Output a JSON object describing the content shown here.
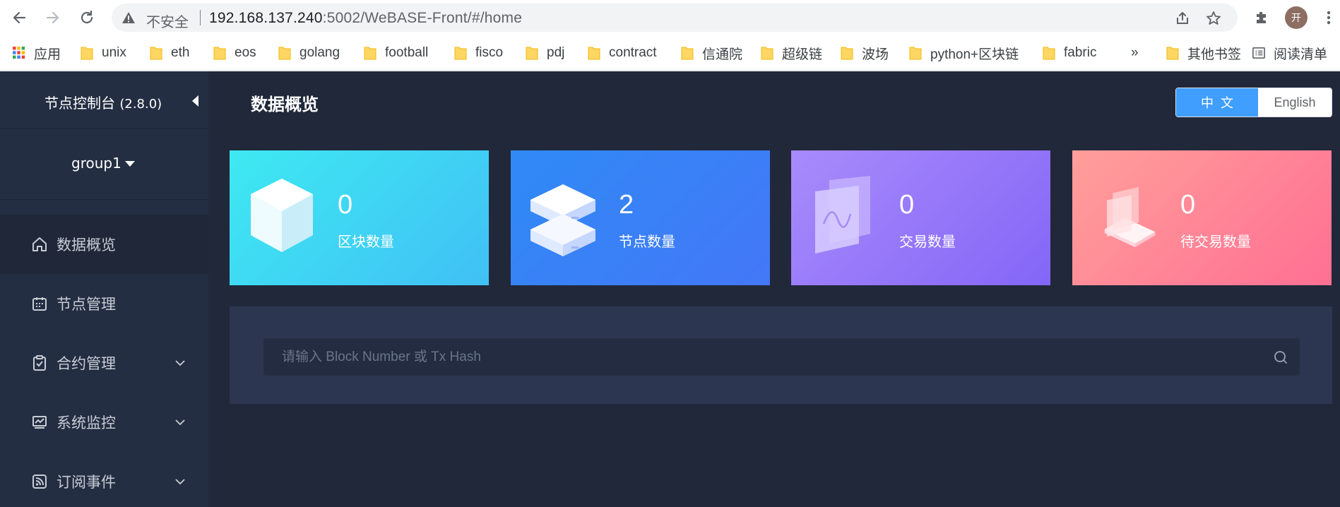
{
  "browser": {
    "security_label": "不安全",
    "url_host": "192.168.137.240",
    "url_rest": ":5002/WeBASE-Front/#/home",
    "avatar_text": "开",
    "bookmarks": [
      {
        "label": "应用",
        "icon": "apps-grid-icon"
      },
      {
        "label": "unix",
        "icon": "folder-icon"
      },
      {
        "label": "eth",
        "icon": "folder-icon"
      },
      {
        "label": "eos",
        "icon": "folder-icon"
      },
      {
        "label": "golang",
        "icon": "folder-icon"
      },
      {
        "label": "football",
        "icon": "folder-icon"
      },
      {
        "label": "fisco",
        "icon": "folder-icon"
      },
      {
        "label": "pdj",
        "icon": "folder-icon"
      },
      {
        "label": "contract",
        "icon": "folder-icon"
      },
      {
        "label": "信通院",
        "icon": "folder-icon"
      },
      {
        "label": "超级链",
        "icon": "folder-icon"
      },
      {
        "label": "波场",
        "icon": "folder-icon"
      },
      {
        "label": "python+区块链",
        "icon": "folder-icon"
      },
      {
        "label": "fabric",
        "icon": "folder-icon"
      }
    ],
    "more_label": "»",
    "other_bookmarks": "其他书签",
    "reading_list": "阅读清单"
  },
  "sidebar": {
    "title": "节点控制台",
    "version": "(2.8.0)",
    "group": "group1",
    "items": [
      {
        "label": "数据概览",
        "icon": "home-icon",
        "active": true,
        "expandable": false
      },
      {
        "label": "节点管理",
        "icon": "calendar-icon",
        "active": false,
        "expandable": false
      },
      {
        "label": "合约管理",
        "icon": "clipboard-check-icon",
        "active": false,
        "expandable": true
      },
      {
        "label": "系统监控",
        "icon": "monitor-chart-icon",
        "active": false,
        "expandable": true
      },
      {
        "label": "订阅事件",
        "icon": "rss-icon",
        "active": false,
        "expandable": true
      }
    ]
  },
  "header": {
    "title": "数据概览",
    "lang_zh": "中文",
    "lang_en": "English"
  },
  "cards": [
    {
      "value": "0",
      "label": "区块数量",
      "icon": "cube-icon"
    },
    {
      "value": "2",
      "label": "节点数量",
      "icon": "server-icon"
    },
    {
      "value": "0",
      "label": "交易数量",
      "icon": "transaction-screen-icon"
    },
    {
      "value": "0",
      "label": "待交易数量",
      "icon": "pending-transaction-icon"
    }
  ],
  "search": {
    "placeholder": "请输入 Block Number 或 Tx Hash"
  },
  "colors": {
    "app_bg": "#20283a",
    "sidebar_bg": "#242e42",
    "accent": "#409eff"
  }
}
